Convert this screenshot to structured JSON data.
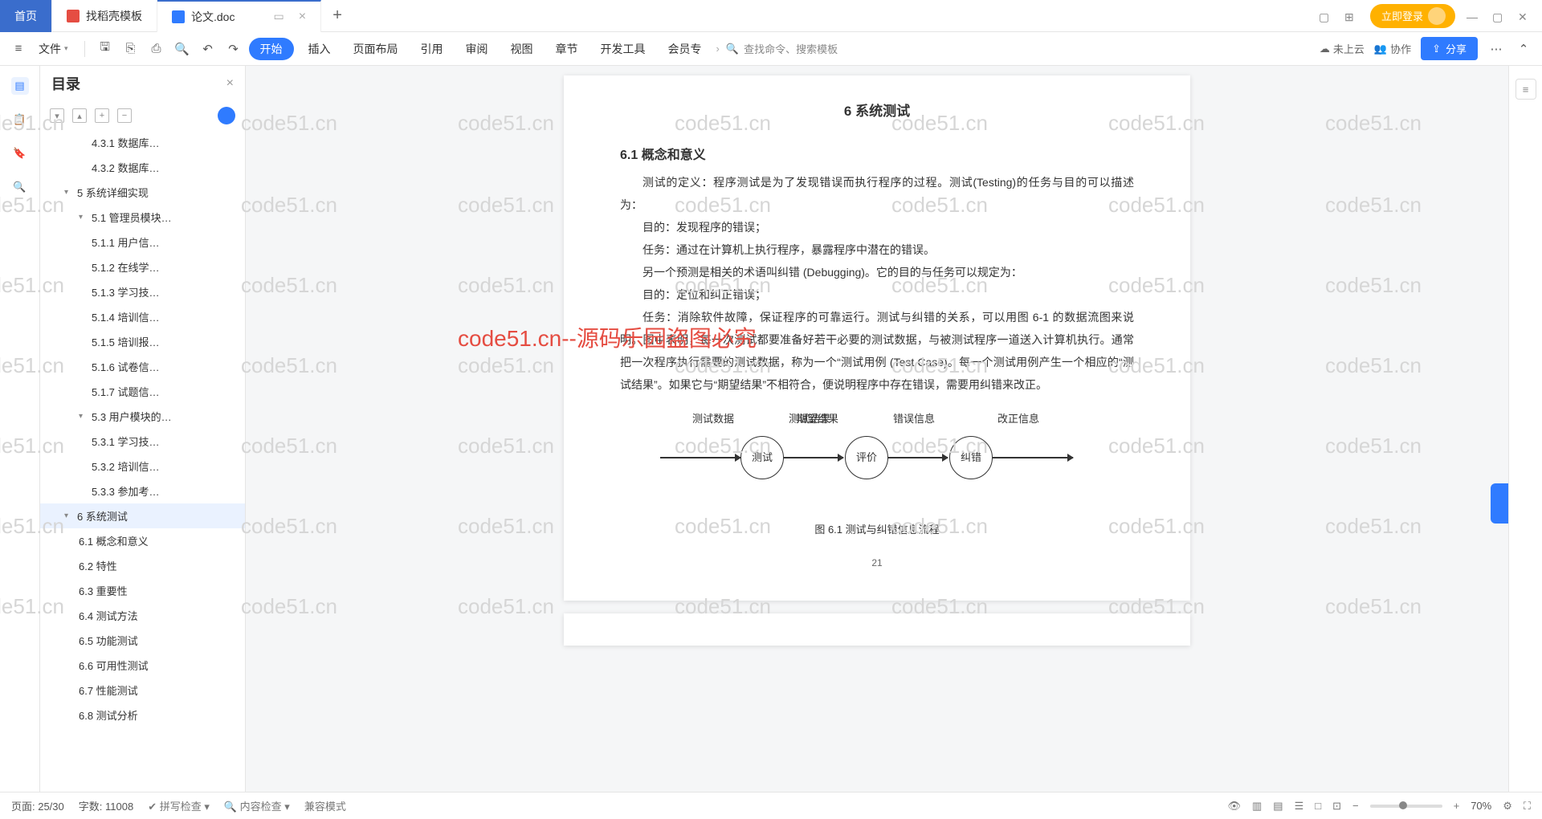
{
  "tabs": {
    "home": "首页",
    "t1": "找稻壳模板",
    "t2": "论文.doc"
  },
  "login": "立即登录",
  "ribbon": {
    "file": "文件",
    "menus": [
      "开始",
      "插入",
      "页面布局",
      "引用",
      "审阅",
      "视图",
      "章节",
      "开发工具",
      "会员专"
    ],
    "search": "查找命令、搜索模板",
    "cloud": "未上云",
    "collab": "协作",
    "share": "分享"
  },
  "outline": {
    "title": "目录",
    "items": [
      {
        "lvl": 3,
        "txt": "4.3.1 数据库…"
      },
      {
        "lvl": 3,
        "txt": "4.3.2 数据库…"
      },
      {
        "lvl": 1,
        "txt": "5 系统详细实现",
        "chev": "▾"
      },
      {
        "lvl": 2,
        "txt": "5.1 管理员模块…",
        "chev": "▾"
      },
      {
        "lvl": 3,
        "txt": "5.1.1 用户信…"
      },
      {
        "lvl": 3,
        "txt": "5.1.2 在线学…"
      },
      {
        "lvl": 3,
        "txt": "5.1.3 学习技…"
      },
      {
        "lvl": 3,
        "txt": "5.1.4 培训信…"
      },
      {
        "lvl": 3,
        "txt": "5.1.5 培训报…"
      },
      {
        "lvl": 3,
        "txt": "5.1.6 试卷信…"
      },
      {
        "lvl": 3,
        "txt": "5.1.7 试题信…"
      },
      {
        "lvl": 2,
        "txt": "5.3 用户模块的…",
        "chev": "▾"
      },
      {
        "lvl": 3,
        "txt": "5.3.1 学习技…"
      },
      {
        "lvl": 3,
        "txt": "5.3.2 培训信…"
      },
      {
        "lvl": 3,
        "txt": "5.3.3 参加考…"
      },
      {
        "lvl": 1,
        "txt": "6 系统测试",
        "chev": "▾",
        "active": true
      },
      {
        "lvl": 2,
        "txt": "6.1 概念和意义"
      },
      {
        "lvl": 2,
        "txt": "6.2 特性"
      },
      {
        "lvl": 2,
        "txt": "6.3 重要性"
      },
      {
        "lvl": 2,
        "txt": "6.4 测试方法"
      },
      {
        "lvl": 2,
        "txt": "6.5 功能测试"
      },
      {
        "lvl": 2,
        "txt": "6.6 可用性测试"
      },
      {
        "lvl": 2,
        "txt": "6.7 性能测试"
      },
      {
        "lvl": 2,
        "txt": "6.8 测试分析"
      }
    ]
  },
  "doc": {
    "chapter": "6 系统测试",
    "h61": "6.1 概念和意义",
    "p1": "测试的定义：程序测试是为了发现错误而执行程序的过程。测试(Testing)的任务与目的可以描述为：",
    "p2": "目的：发现程序的错误；",
    "p3": "任务：通过在计算机上执行程序，暴露程序中潜在的错误。",
    "p4": "另一个预测是相关的术语叫纠错 (Debugging)。它的目的与任务可以规定为：",
    "p5": "目的：定位和纠正错误；",
    "p6": "任务：消除软件故障，保证程序的可靠运行。测试与纠错的关系，可以用图 6-1 的数据流图来说明。图中表明，每一次测试都要准备好若干必要的测试数据，与被测试程序一道送入计算机执行。通常把一次程序执行需要的测试数据，称为一个“测试用例 (Test Case)。每一个测试用例产生一个相应的“测试结果”。如果它与“期望结果”不相符合，便说明程序中存在错误，需要用纠错来改正。",
    "labels": {
      "l1": "测试数据",
      "l2": "期望结果",
      "n1": "测试",
      "n2": "评价",
      "n3": "纠错",
      "a1": "测试结果",
      "a2": "错误信息",
      "a3": "改正信息"
    },
    "caption": "图 6.1 测试与纠错信息流程",
    "pagenum": "21"
  },
  "status": {
    "page": "页面: 25/30",
    "words": "字数: 11008",
    "spell": "拼写检查",
    "content": "内容检查",
    "compat": "兼容模式",
    "zoom": "70%"
  },
  "wm": "code51.cn",
  "wm_red": "code51.cn--源码乐园盗图必究"
}
